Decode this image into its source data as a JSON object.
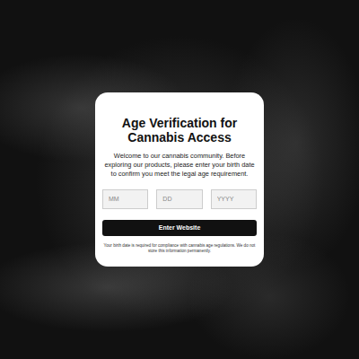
{
  "dialog": {
    "title": "Age Verification for Cannabis Access",
    "description": "Welcome to our cannabis community. Before exploring our products, please enter your birth date to confirm you meet the legal age requirement.",
    "fields": [
      {
        "placeholder": "MM"
      },
      {
        "placeholder": "DD"
      },
      {
        "placeholder": "YYYY"
      }
    ],
    "button": "Enter Website",
    "note": "Your birth date is required for compliance with cannabis age regulations. We do not store this information permanently."
  }
}
